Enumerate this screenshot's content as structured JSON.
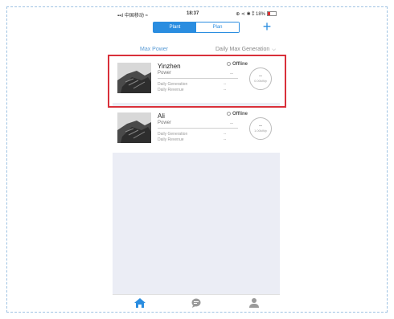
{
  "statusbar": {
    "carrier": "▪▪ıl 中国移动 ≈",
    "time": "18:37",
    "indicators": "⊕ ⋖ ✱ ⁑ 18%"
  },
  "header": {
    "tabs": [
      {
        "label": "Plant",
        "active": true
      },
      {
        "label": "Plan",
        "active": false
      }
    ],
    "add_icon": "plus-icon"
  },
  "filter": {
    "left_label": "Max Power",
    "right_label": "Daily Max Generation",
    "right_icon": "chevron-down-icon"
  },
  "plants": [
    {
      "name": "Yinzhen",
      "status": "Offline",
      "power_label": "Power",
      "power_value": "--",
      "generation_label": "Daily Generation",
      "generation_value": "--",
      "revenue_label": "Daily Revenue",
      "revenue_value": "--",
      "gauge_value": "--",
      "gauge_unit": "0.00kWp"
    },
    {
      "name": "Ali",
      "status": "Offline",
      "power_label": "Power",
      "power_value": "--",
      "generation_label": "Daily Generation",
      "generation_value": "--",
      "revenue_label": "Daily Revenue",
      "revenue_value": "--",
      "gauge_value": "--",
      "gauge_unit": "1.00kWp"
    }
  ],
  "tabbar": {
    "items": [
      {
        "icon": "home-icon",
        "active": true,
        "color": "#2a8de0"
      },
      {
        "icon": "message-icon",
        "active": false,
        "color": "#9a9a9a"
      },
      {
        "icon": "user-icon",
        "active": false,
        "color": "#9a9a9a"
      }
    ]
  },
  "colors": {
    "accent": "#2a8de0",
    "highlight": "#d9303a",
    "list_background": "#ebedf5"
  }
}
